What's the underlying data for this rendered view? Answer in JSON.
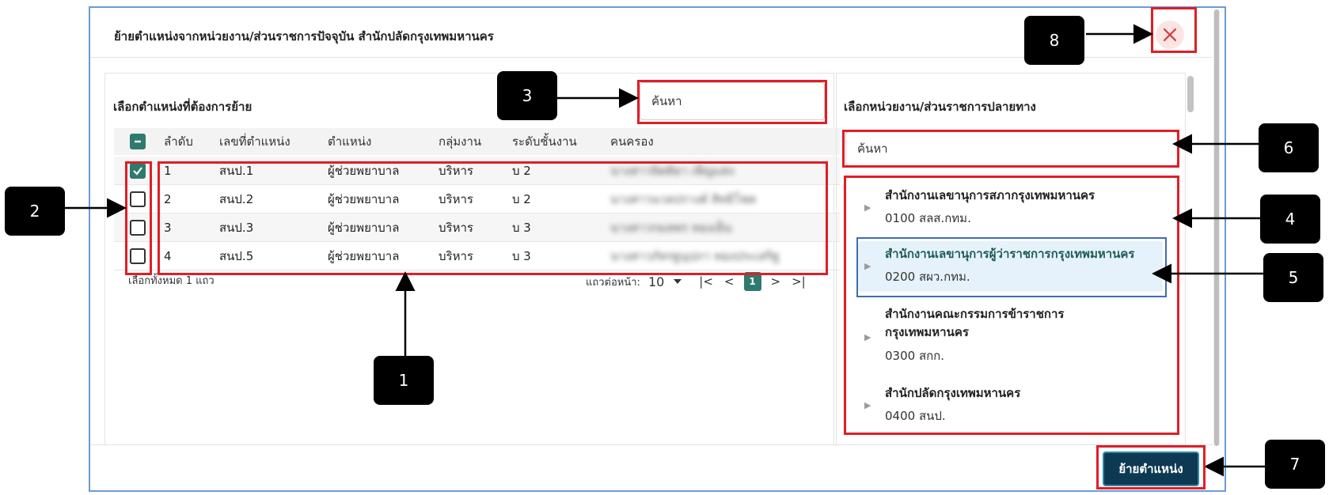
{
  "dialog": {
    "title": "ย้ายตำแหน่งจากหน่วยงาน/ส่วนราชการปัจจุบัน สำนักปลัดกรุงเทพมหานคร",
    "close_icon": "close-icon",
    "move_button_label": "ย้ายตำแหน่ง"
  },
  "left_panel": {
    "title": "เลือกตำแหน่งที่ต้องการย้าย",
    "search_placeholder": "ค้นหา",
    "columns": [
      "ลำดับ",
      "เลขที่ตำแหน่ง",
      "ตำแหน่ง",
      "กลุ่มงาน",
      "ระดับชั้นงาน",
      "คนครอง"
    ],
    "rows": [
      {
        "checked": true,
        "order": "1",
        "position_no": "สนป.1",
        "position": "ผู้ช่วยพยาบาล",
        "group": "บริหาร",
        "level": "บ 2",
        "holder": "นางสาวจิตติยา เพ็ญแสง"
      },
      {
        "checked": false,
        "order": "2",
        "position_no": "สนป.2",
        "position": "ผู้ช่วยพยาบาล",
        "group": "บริหาร",
        "level": "บ 2",
        "holder": "นางสาวนวลปรางค์ สิทธิโชค"
      },
      {
        "checked": false,
        "order": "3",
        "position_no": "สนป.3",
        "position": "ผู้ช่วยพยาบาล",
        "group": "บริหาร",
        "level": "บ 3",
        "holder": "นางสาวกมลพร ทองเย็น"
      },
      {
        "checked": false,
        "order": "4",
        "position_no": "สนป.5",
        "position": "ผู้ช่วยพยาบาล",
        "group": "บริหาร",
        "level": "บ 3",
        "holder": "นางสาวภัทรฐนุปภา ทองประเสริฐ"
      }
    ],
    "selection_summary": "เลือกทั้งหมด 1 แถว",
    "rows_per_page_label": "แถวต่อหน้า:",
    "rows_per_page_value": "10",
    "current_page": "1",
    "pager_icons": {
      "first": "|<",
      "prev": "<",
      "next": ">",
      "last": ">|"
    }
  },
  "right_panel": {
    "title": "เลือกหน่วยงาน/ส่วนราชการปลายทาง",
    "search_placeholder": "ค้นหา",
    "tree": [
      {
        "name": "สำนักงานเลขานุการสภากรุงเทพมหานคร",
        "code": "0100 สลส.กทม.",
        "selected": false
      },
      {
        "name": "สำนักงานเลขานุการผู้ว่าราชการกรุงเทพมหานคร",
        "code": "0200 สผว.กทม.",
        "selected": true
      },
      {
        "name": "สำนักงานคณะกรรมการข้าราชการ กรุงเทพมหานคร",
        "code": "0300 สกก.",
        "selected": false
      },
      {
        "name": "สำนักปลัดกรุงเทพมหานคร",
        "code": "0400 สนป.",
        "selected": false
      }
    ]
  },
  "annotations": {
    "labels": [
      "1",
      "2",
      "3",
      "4",
      "5",
      "6",
      "7",
      "8"
    ],
    "highlight_color": "#e01e26",
    "callout_color": "#000000"
  },
  "colors": {
    "accent": "#2f7a6f",
    "button": "#0d3a52",
    "selected_bg": "#e6f2fb",
    "dialog_border": "#6b9bd8"
  }
}
